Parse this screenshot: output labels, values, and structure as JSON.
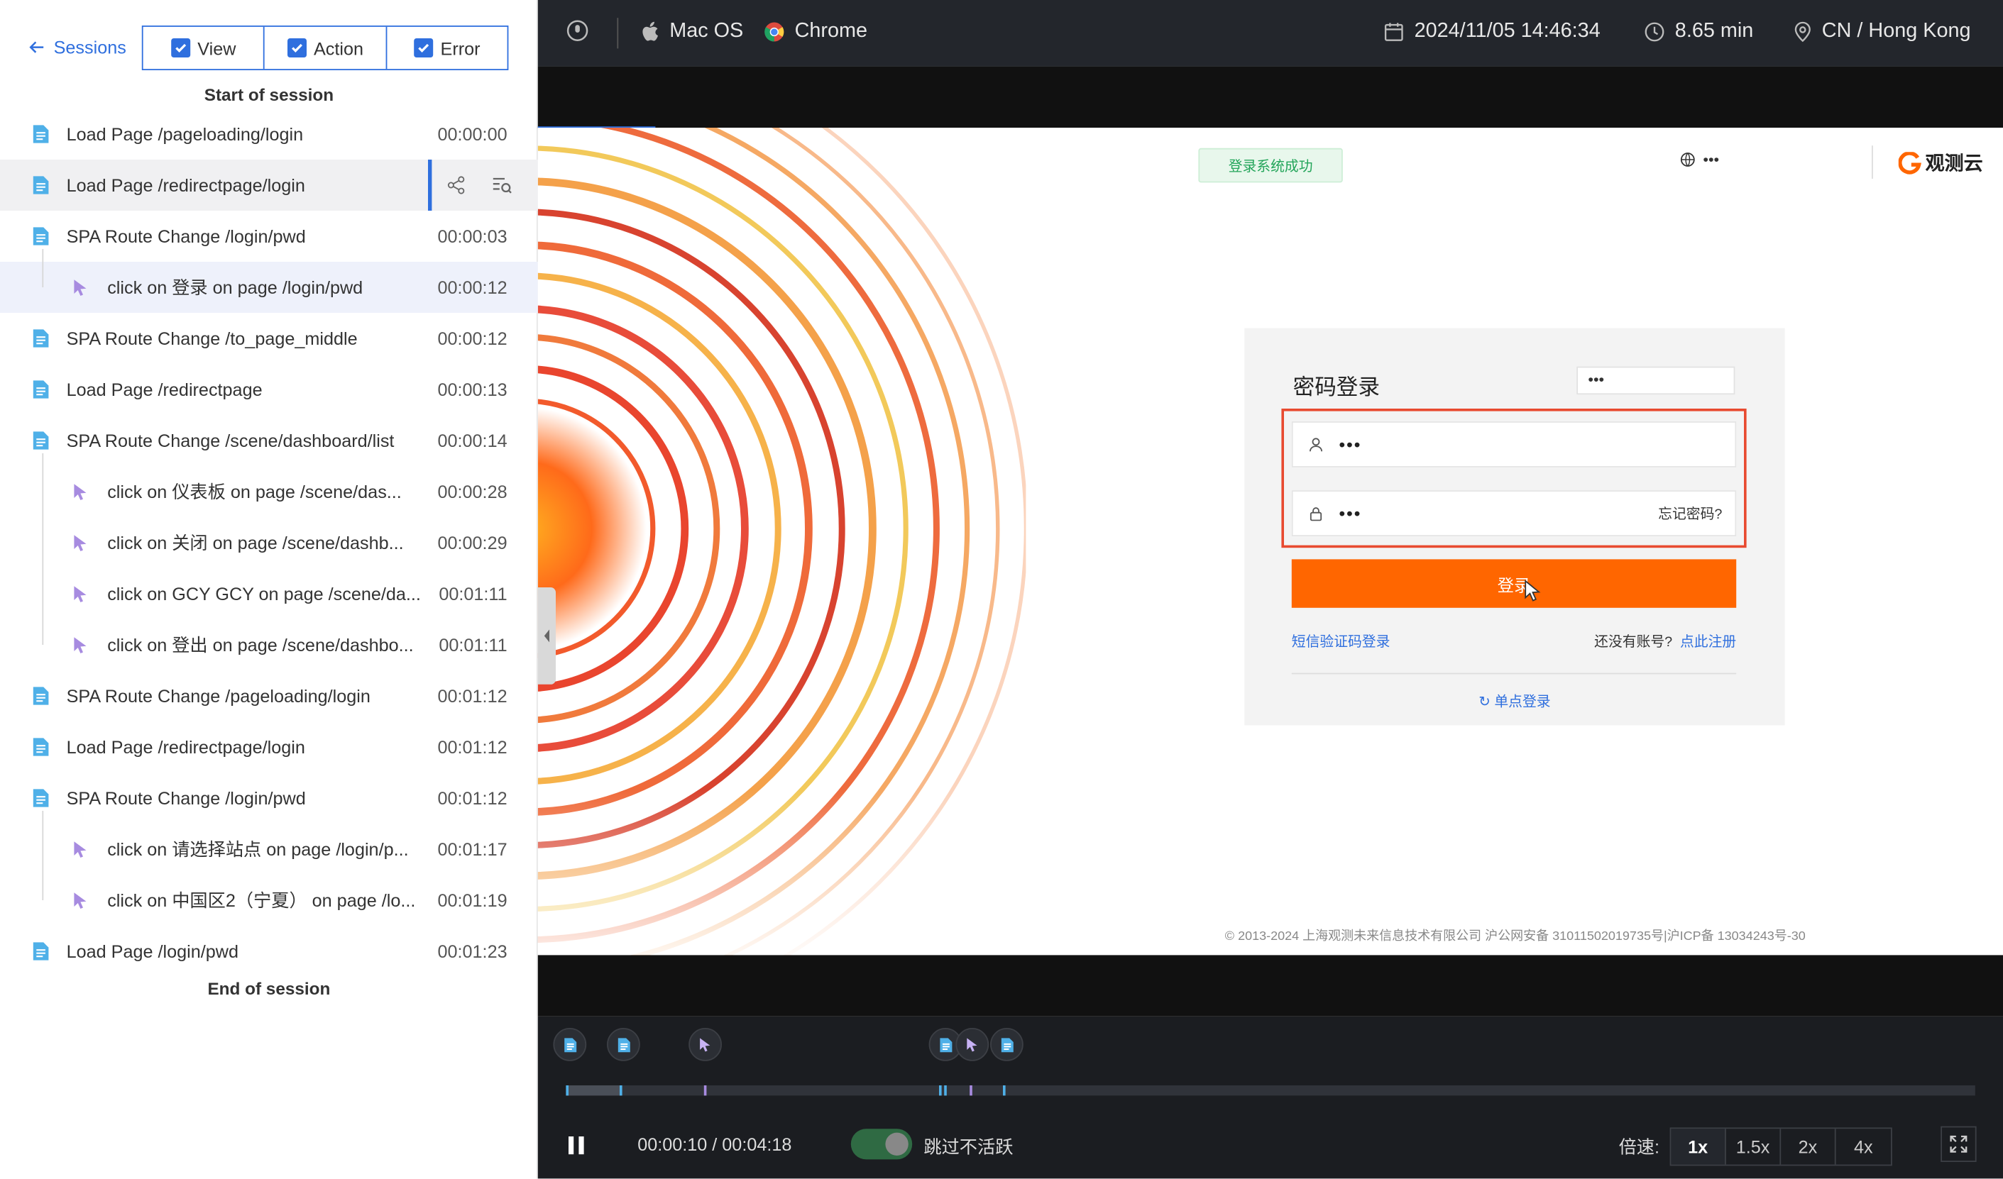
{
  "topbar": {
    "back_label": "Sessions",
    "filters": [
      {
        "label": "View"
      },
      {
        "label": "Action"
      },
      {
        "label": "Error"
      }
    ]
  },
  "start_label": "Start of session",
  "end_label": "End of session",
  "events": [
    {
      "type": "page",
      "label": "Load Page /pageloading/login",
      "time": "00:00:00"
    },
    {
      "type": "page",
      "label": "Load Page /redirectpage/login",
      "time": ""
    },
    {
      "type": "page",
      "label": "SPA Route Change /login/pwd",
      "time": "00:00:03"
    },
    {
      "type": "click",
      "label": "click on 登录 on page /login/pwd",
      "time": "00:00:12"
    },
    {
      "type": "page",
      "label": "SPA Route Change /to_page_middle",
      "time": "00:00:12"
    },
    {
      "type": "page",
      "label": "Load Page /redirectpage",
      "time": "00:00:13"
    },
    {
      "type": "page",
      "label": "SPA Route Change /scene/dashboard/list",
      "time": "00:00:14"
    },
    {
      "type": "click",
      "label": "click on 仪表板 on page /scene/das...",
      "time": "00:00:28"
    },
    {
      "type": "click",
      "label": "click on 关闭 on page /scene/dashb...",
      "time": "00:00:29"
    },
    {
      "type": "click",
      "label": "click on GCY GCY on page /scene/da...",
      "time": "00:01:11"
    },
    {
      "type": "click",
      "label": "click on 登出 on page /scene/dashbo...",
      "time": "00:01:11"
    },
    {
      "type": "page",
      "label": "SPA Route Change /pageloading/login",
      "time": "00:01:12"
    },
    {
      "type": "page",
      "label": "Load Page /redirectpage/login",
      "time": "00:01:12"
    },
    {
      "type": "page",
      "label": "SPA Route Change /login/pwd",
      "time": "00:01:12"
    },
    {
      "type": "click",
      "label": "click on 请选择站点 on page /login/p...",
      "time": "00:01:17"
    },
    {
      "type": "click",
      "label": "click on 中国区2（宁夏） on page /lo...",
      "time": "00:01:19"
    },
    {
      "type": "page",
      "label": "Load Page /login/pwd",
      "time": "00:01:23"
    }
  ],
  "header": {
    "os": "Mac OS",
    "browser": "Chrome",
    "datetime": "2024/11/05 14:46:34",
    "duration": "8.65 min",
    "location": "CN / Hong Kong"
  },
  "replay": {
    "toast": "登录系统成功",
    "lang_dots": "•••",
    "brand": "观测云",
    "card_title": "密码登录",
    "site_select": "•••",
    "username": "•••",
    "password": "•••",
    "forgot": "忘记密码?",
    "login_button": "登录",
    "sms_login": "短信验证码登录",
    "no_account": "还没有账号?",
    "register": "点此注册",
    "sso": "单点登录",
    "footer": "© 2013-2024 上海观测未来信息技术有限公司 沪公网安备 31011502019735号|沪ICP备 13034243号-30"
  },
  "player": {
    "time": "00:00:10 / 00:04:18",
    "skip_label": "跳过不活跃",
    "speed_label": "倍速:",
    "speeds": [
      "1x",
      "1.5x",
      "2x",
      "4x"
    ],
    "active_speed": "1x",
    "progress_fraction": 0.039
  },
  "colors": {
    "accent": "#2f6fde",
    "login_orange": "#ff6600",
    "highlight_red": "#e84a30"
  }
}
